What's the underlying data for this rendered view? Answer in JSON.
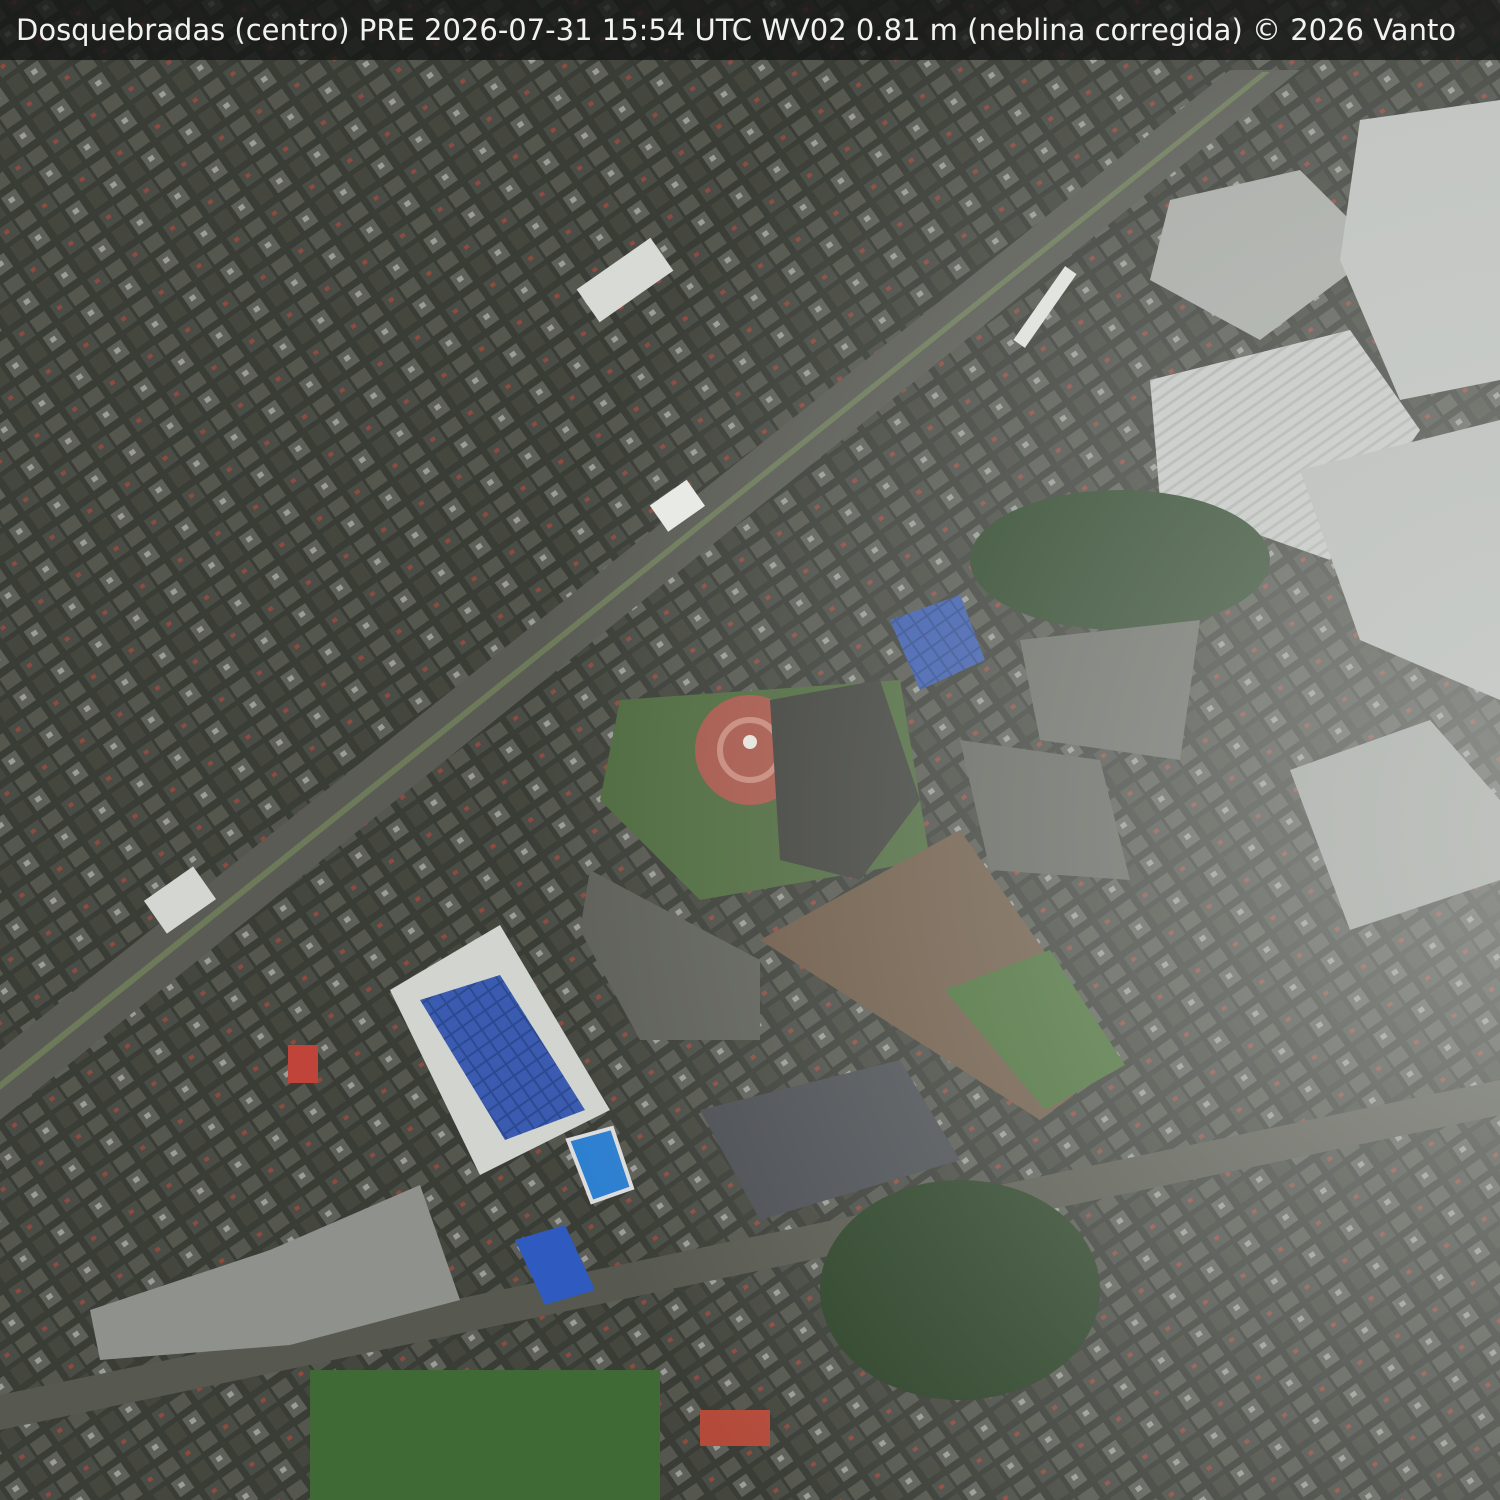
{
  "image": {
    "kind": "satellite-aerial-urban",
    "caption": "Dosquebradas (centro)  PRE  2026-07-31 15:54 UTC  WV02 0.81 m  (neblina corregida)   © 2026 Vanto",
    "palette": {
      "urban_dark": "#3b3d37",
      "roof_grey": "#8c8f8a",
      "roof_white": "#d9dbd7",
      "roof_red": "#b44a3a",
      "solar_blue": "#2f4f9a",
      "pool_blue": "#2d7fd0",
      "vegetation": "#2f4a2a",
      "grass": "#3f6a35",
      "dirt_field": "#6e5a47",
      "plaza_brick": "#a8574a",
      "haze": "#cfd3cf"
    }
  }
}
